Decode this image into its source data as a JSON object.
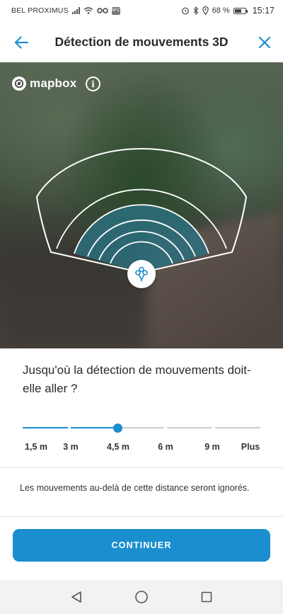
{
  "status_bar": {
    "carrier": "BEL PROXIMUS",
    "nfc": "NFC",
    "battery": "68 %",
    "time": "15:17",
    "icons": [
      "signal-icon",
      "wifi-icon",
      "vr-icon",
      "nfc-icon",
      "alarm-icon",
      "bluetooth-icon",
      "location-icon",
      "battery-icon"
    ]
  },
  "header": {
    "title": "Détection de mouvements 3D",
    "back_icon": "arrow-left-icon",
    "close_icon": "close-icon"
  },
  "map": {
    "logo_text": "mapbox",
    "info_label": "i",
    "device_icon": "motion-sensor-icon"
  },
  "question": "Jusqu'où la détection de mouvements doit-elle aller ?",
  "slider": {
    "labels": [
      "1,5 m",
      "3 m",
      "4,5 m",
      "6 m",
      "9 m",
      "Plus"
    ],
    "selected_index": 2,
    "selected_value": "4,5 m"
  },
  "note": "Les mouvements au-delà de cette distance seront ignorés.",
  "continue_label": "CONTINUER",
  "nav_bar": {
    "icons": [
      "back-triangle-icon",
      "home-circle-icon",
      "recents-square-icon"
    ]
  },
  "colors": {
    "accent": "#1a8ecf",
    "zone_fill": "#2b6f7c",
    "track_inactive": "#cccccc"
  }
}
